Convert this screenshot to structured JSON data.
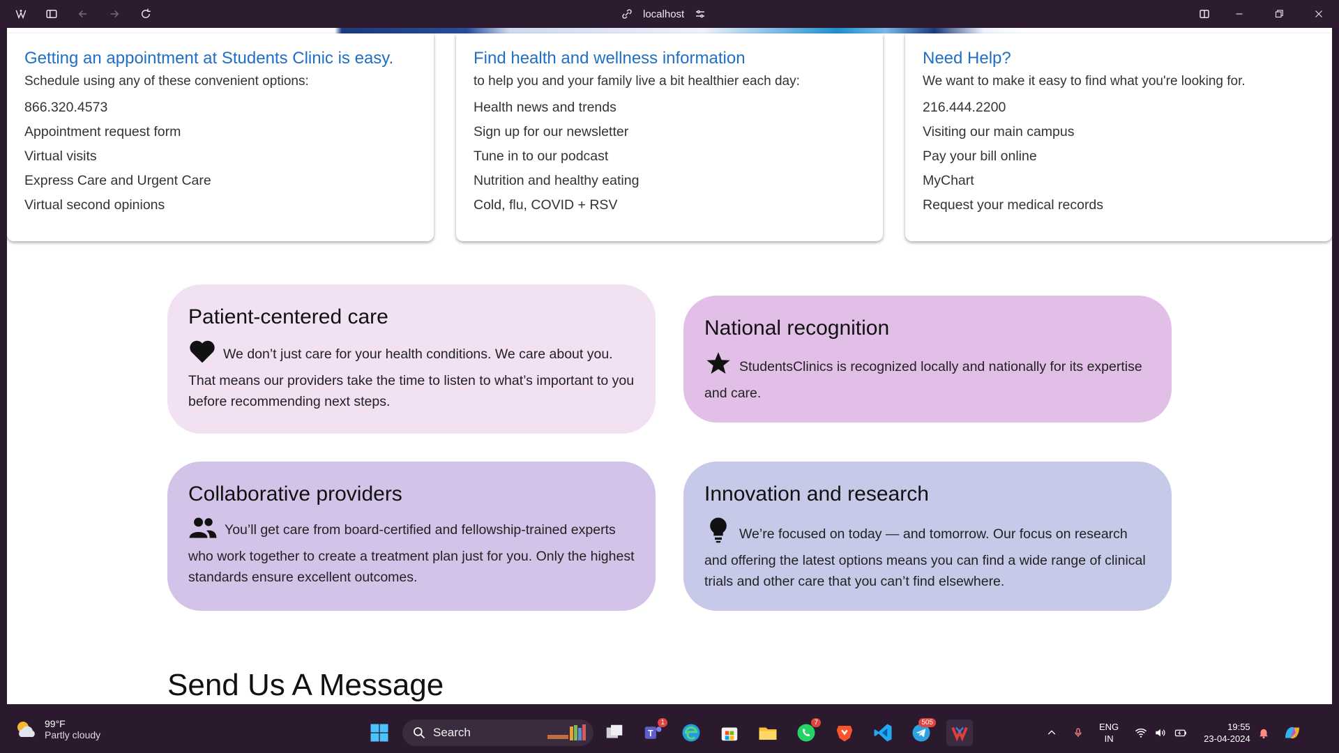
{
  "browser": {
    "address": "localhost"
  },
  "info_cards": [
    {
      "title": "Getting an appointment at Students Clinic is easy.",
      "intro": "Schedule using any of these convenient options:",
      "items": [
        "866.320.4573",
        "Appointment request form",
        "Virtual visits",
        "Express Care and Urgent Care",
        "Virtual second opinions"
      ]
    },
    {
      "title": "Find health and wellness information",
      "intro": "to help you and your family live a bit healthier each day:",
      "items": [
        "Health news and trends",
        "Sign up for our newsletter",
        "Tune in to our podcast",
        "Nutrition and healthy eating",
        "Cold, flu, COVID + RSV"
      ]
    },
    {
      "title": "Need Help?",
      "intro": "We want to make it easy to find what you're looking for.",
      "items": [
        "216.444.2200",
        "Visiting our main campus",
        "Pay your bill online",
        "MyChart",
        "Request your medical records"
      ]
    }
  ],
  "features": [
    {
      "title": "Patient-centered care",
      "icon": "heart-icon",
      "text": "We don’t just care for your health conditions. We care about you. That means our providers take the time to listen to what’s important to you before recommending next steps.",
      "color": "#f2e1f3"
    },
    {
      "title": "National recognition",
      "icon": "star-icon",
      "text": "StudentsClinics is recognized locally and nationally for its expertise and care.",
      "color": "#e2bfe6"
    },
    {
      "title": "Collaborative providers",
      "icon": "people-icon",
      "text": "You’ll get care from board-certified and fellowship-trained experts who work together to create a treatment plan just for you. Only the highest standards ensure excellent outcomes.",
      "color": "#d3c3e8"
    },
    {
      "title": "Innovation and research",
      "icon": "lightbulb-icon",
      "text": "We’re focused on today — and tomorrow. Our focus on research and offering the latest options means you can find a wide range of clinical trials and other care that you can’t find elsewhere.",
      "color": "#c6c9e8"
    }
  ],
  "send_message_title": "Send Us A Message",
  "taskbar": {
    "weather_temp": "99°F",
    "weather_condition": "Partly cloudy",
    "search_label": "Search",
    "teams_badge": "1",
    "whatsapp_badge": "7",
    "telegram_badge": "505",
    "lang_top": "ENG",
    "lang_bottom": "IN",
    "time": "19:55",
    "date": "23-04-2024"
  }
}
